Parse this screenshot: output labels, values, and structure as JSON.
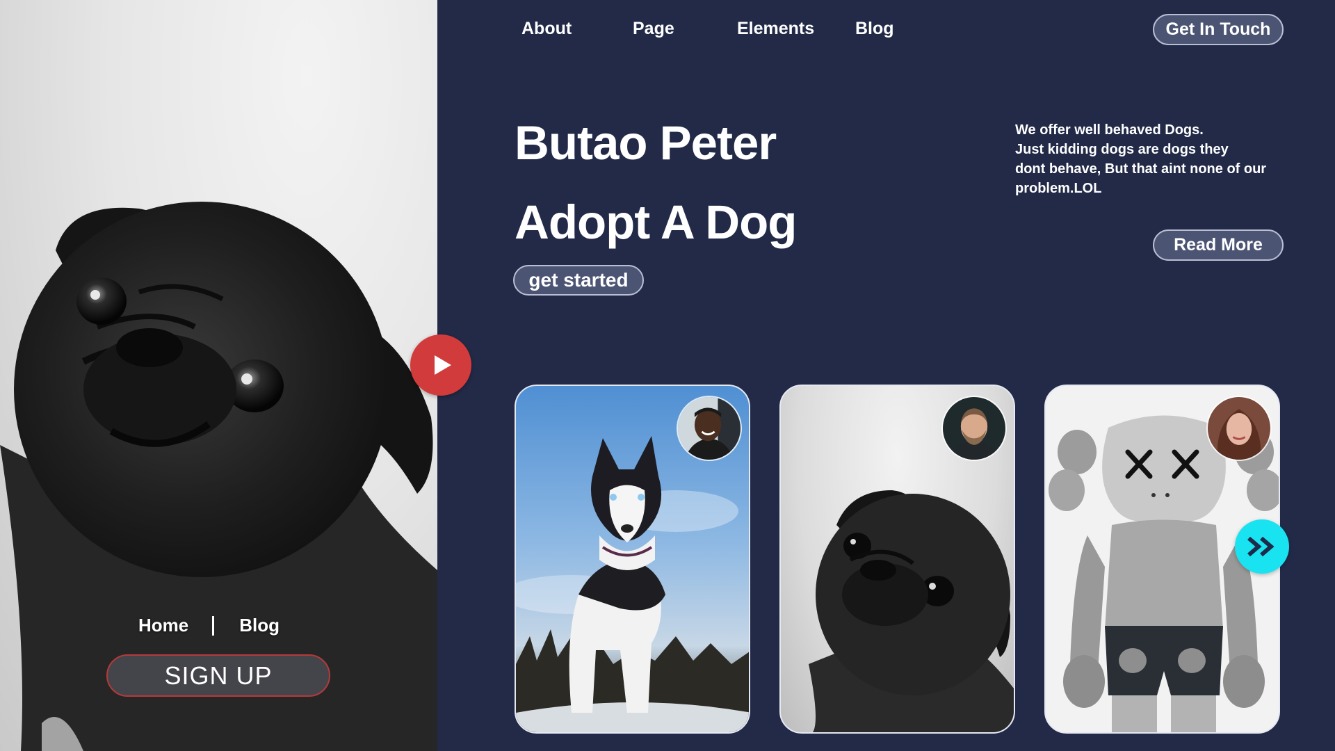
{
  "nav": {
    "links": [
      "About",
      "Page",
      "Elements",
      "Blog"
    ],
    "cta_label": "Get In Touch"
  },
  "left_panel": {
    "links": [
      "Home",
      "Blog"
    ],
    "signup_label": "SIGN UP"
  },
  "hero": {
    "title_line1": "Butao Peter",
    "title_line2": "Adopt A Dog",
    "start_label": "get started",
    "description_lines": [
      "We offer well behaved Dogs.",
      "Just kidding dogs are dogs they",
      "dont behave, But that aint none of our",
      "problem.LOL"
    ],
    "read_more_label": "Read More"
  },
  "cards": [
    {
      "subject": "husky-photo",
      "avatar": "man-avatar"
    },
    {
      "subject": "pug-photo",
      "avatar": "bearded-man-avatar"
    },
    {
      "subject": "toy-figure-photo",
      "avatar": "woman-avatar"
    }
  ],
  "colors": {
    "background": "#222a48",
    "button_fill": "#4b5473",
    "play_button": "#d23b3b",
    "next_button": "#19e3f0"
  },
  "icons": {
    "play": "play-icon",
    "next": "double-chevron-right-icon"
  }
}
